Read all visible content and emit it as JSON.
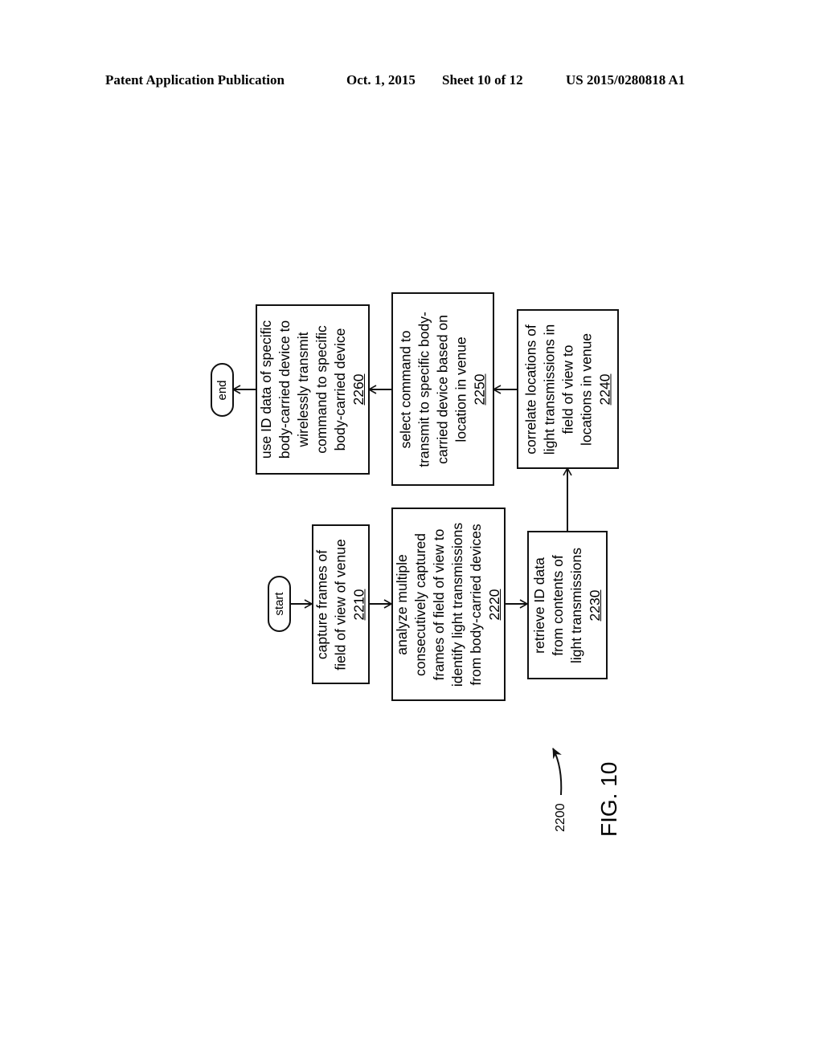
{
  "header": {
    "publication": "Patent Application Publication",
    "date": "Oct. 1, 2015",
    "sheet": "Sheet 10 of 12",
    "number": "US 2015/0280818 A1"
  },
  "figure": {
    "label": "FIG. 10",
    "ref": "2200"
  },
  "terminals": {
    "start": "start",
    "end": "end"
  },
  "steps": [
    {
      "id": "2210",
      "lines": [
        "capture frames of",
        "field of view of venue"
      ]
    },
    {
      "id": "2220",
      "lines": [
        "analyze multiple",
        "consecutively captured",
        "frames of field of view to",
        "identify light transmissions",
        "from body-carried devices"
      ]
    },
    {
      "id": "2230",
      "lines": [
        "retrieve ID data",
        "from contents of",
        "light transmissions"
      ]
    },
    {
      "id": "2240",
      "lines": [
        "correlate locations of",
        "light transmissions in",
        "field of view to",
        "locations in venue"
      ]
    },
    {
      "id": "2250",
      "lines": [
        "select command to",
        "transmit to specific body-",
        "carried device based on",
        "location in venue"
      ]
    },
    {
      "id": "2260",
      "lines": [
        "use ID data of specific",
        "body-carried device to",
        "wirelessly transmit",
        "command to specific",
        "body-carried device"
      ]
    }
  ]
}
